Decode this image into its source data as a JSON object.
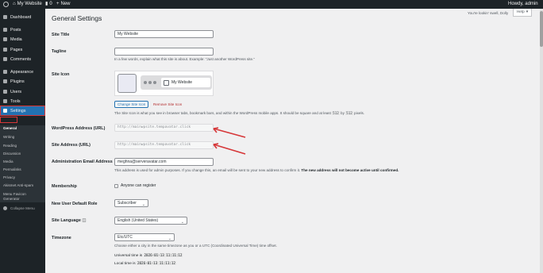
{
  "adminbar": {
    "site_name": "My Website",
    "comments_count": "0",
    "new_label": "New",
    "howdy": "Howdy, admin"
  },
  "sidebar": {
    "items": [
      {
        "label": "Dashboard",
        "icon": "dashboard-icon"
      },
      {
        "label": "Posts",
        "icon": "pin-icon"
      },
      {
        "label": "Media",
        "icon": "media-icon"
      },
      {
        "label": "Pages",
        "icon": "page-icon"
      },
      {
        "label": "Comments",
        "icon": "comment-icon"
      },
      {
        "label": "Appearance",
        "icon": "brush-icon"
      },
      {
        "label": "Plugins",
        "icon": "plugin-icon"
      },
      {
        "label": "Users",
        "icon": "users-icon"
      },
      {
        "label": "Tools",
        "icon": "wrench-icon"
      },
      {
        "label": "Settings",
        "icon": "settings-icon"
      }
    ],
    "submenu": [
      "General",
      "Writing",
      "Reading",
      "Discussion",
      "Media",
      "Permalinks",
      "Privacy",
      "Akismet Anti-spam",
      "Menu Favicon",
      "Generator"
    ],
    "collapse_label": "Collapse Menu"
  },
  "header": {
    "title": "General Settings",
    "screen_msg": "You're lookin' swell, Dolly",
    "help_label": "Help"
  },
  "form": {
    "site_title": {
      "label": "Site Title",
      "value": "My Website"
    },
    "tagline": {
      "label": "Tagline",
      "value": "",
      "desc": "In a few words, explain what this site is about. Example: “Just another WordPress site.”"
    },
    "site_icon": {
      "label": "Site Icon",
      "preview_title": "My Website",
      "change_label": "Change Site Icon",
      "remove_label": "Remove Site Icon",
      "desc_before": "The Site Icon is what you see in browser tabs, bookmark bars, and within the WordPress mobile apps. It should be square and at least",
      "desc_size1": "512",
      "desc_by": "by",
      "desc_size2": "512",
      "desc_after": "pixels."
    },
    "wp_address": {
      "label": "WordPress Address (URL)",
      "value": "http://mainwpsite.tempavatar.click"
    },
    "site_address": {
      "label": "Site Address (URL)",
      "value": "http://mainwpsite.tempavatar.click"
    },
    "admin_email": {
      "label": "Administration Email Address",
      "value": "meghna@serveravatar.com",
      "desc": "This address is used for admin purposes. If you change this, an email will be sent to your new address to confirm it.",
      "desc_bold": "The new address will not become active until confirmed."
    },
    "membership": {
      "label": "Membership",
      "checkbox_label": "Anyone can register",
      "checked": false
    },
    "default_role": {
      "label": "New User Default Role",
      "value": "Subscriber"
    },
    "site_language": {
      "label": "Site Language",
      "value": "English (United States)"
    },
    "timezone": {
      "label": "Timezone",
      "value": "Etc/UTC",
      "desc": "Choose either a city in the same timezone as you or a UTC (Coordinated Universal Time) time offset.",
      "universal_label": "Universal time is",
      "universal_value": "2026-01-13 11:11:12",
      "local_label": "Local time is",
      "local_value": "2026-01-13 11:11:12"
    }
  },
  "colors": {
    "accent": "#2271b1",
    "annotation": "#d63638",
    "sidebar_bg": "#1d2327"
  }
}
